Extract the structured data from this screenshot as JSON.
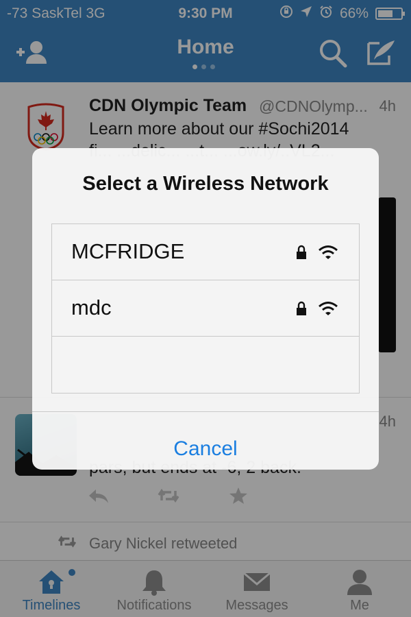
{
  "status_bar": {
    "carrier": "-73 SaskTel  3G",
    "time": "9:30 PM",
    "battery_text": "66%",
    "battery_level": 0.66
  },
  "nav": {
    "title": "Home",
    "page_count": 3,
    "active_page": 0
  },
  "timeline": {
    "tweets": [
      {
        "name": "CDN Olympic Team",
        "handle": "@CDNOlymp...",
        "time": "4h",
        "text_line1": "Learn more about our #Sochi2014",
        "text_line2": "fi... ...delic... ...t... ...ow.ly/..VL2..."
      },
      {
        "time": "4h",
        "text_line": "pars, but ends at -6, 2 back."
      }
    ],
    "retweet_notice": "Gary Nickel retweeted"
  },
  "tabs": [
    {
      "label": "Timelines",
      "icon": "home-icon",
      "active": true
    },
    {
      "label": "Notifications",
      "icon": "bell-icon",
      "active": false
    },
    {
      "label": "Messages",
      "icon": "envelope-icon",
      "active": false
    },
    {
      "label": "Me",
      "icon": "person-icon",
      "active": false
    }
  ],
  "alert": {
    "title": "Select a Wireless Network",
    "networks": [
      {
        "name": "MCFRIDGE",
        "secured": true,
        "signal": "full"
      },
      {
        "name": "mdc",
        "secured": true,
        "signal": "full"
      }
    ],
    "cancel_label": "Cancel"
  },
  "colors": {
    "brand_blue": "#3f86c3",
    "link_blue": "#1a7ee0",
    "olympic_red": "#d52b1e"
  }
}
